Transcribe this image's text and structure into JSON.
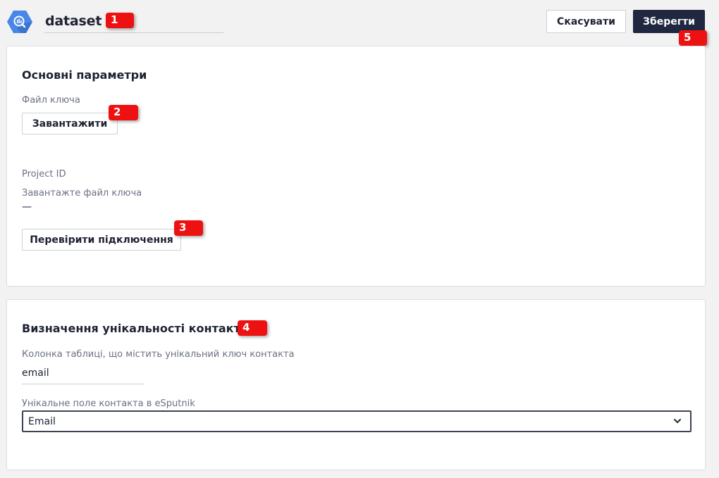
{
  "header": {
    "title": "dataset",
    "cancel_label": "Скасувати",
    "save_label": "Зберегти"
  },
  "badges": [
    "1",
    "2",
    "3",
    "4",
    "5"
  ],
  "main_section": {
    "title": "Основні параметри",
    "key_file_label": "Файл ключа",
    "upload_label": "Завантажити",
    "project_id_label": "Project ID",
    "project_id_hint": "Завантажте файл ключа",
    "project_id_value": "—",
    "check_connection_label": "Перевірити підключення"
  },
  "uniqueness_section": {
    "title": "Визначення унікальності контакта",
    "column_label": "Колонка таблиці, що містить унікальний ключ контакта",
    "column_value": "email",
    "field_label": "Унікальне поле контакта в eSputnik",
    "field_value": "Email"
  },
  "colors": {
    "accent_dark": "#1f2840",
    "badge_red": "#ee1111",
    "logo_blue": "#4a86e8"
  },
  "icons": {
    "logo": "bigquery-hexagon-icon",
    "select": "chevron-down-icon"
  }
}
